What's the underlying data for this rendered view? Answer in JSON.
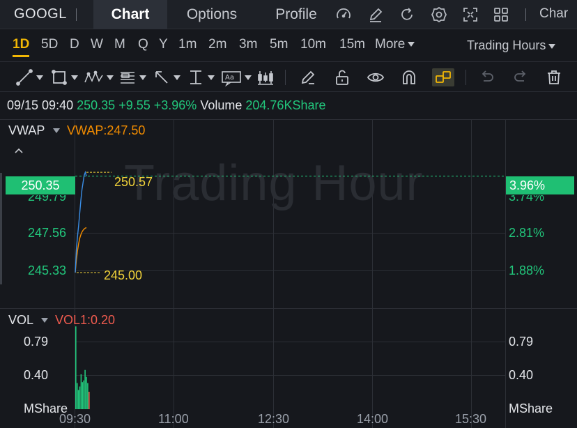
{
  "topbar": {
    "ticker": "GOOGL",
    "tabs": [
      {
        "label": "Chart",
        "active": true
      },
      {
        "label": "Options",
        "active": false
      },
      {
        "label": "Profile",
        "active": false
      }
    ],
    "right_label": "Char",
    "icons": [
      "gauge-icon",
      "edit-icon",
      "refresh-icon",
      "settings-icon",
      "fullscreen-icon",
      "grid-icon"
    ]
  },
  "periods": {
    "items": [
      "1D",
      "5D",
      "D",
      "W",
      "M",
      "Q",
      "Y",
      "1m",
      "2m",
      "3m",
      "5m",
      "10m",
      "15m"
    ],
    "active": "1D",
    "more_label": "More",
    "session_label": "Trading Hours"
  },
  "tools": [
    "trendline-icon",
    "rectangle-icon",
    "pattern-icon",
    "fib-icon",
    "arrow-icon",
    "measure-icon",
    "text-icon",
    "candle-icon",
    "pen-icon",
    "unlock-icon",
    "eye-icon",
    "magnet-icon",
    "link-icon",
    "undo-icon",
    "redo-icon",
    "trash-icon"
  ],
  "quote": {
    "datetime": "09/15 09:40",
    "price": "250.35",
    "change": "+9.55",
    "change_pct": "+3.96%",
    "volume_label": "Volume",
    "volume_value": "204.76KShare"
  },
  "price_panel": {
    "indicator": "VWAP",
    "indicator_value": "VWAP:247.50",
    "watermark": "Trading Hour",
    "last_price_tag": "250.35",
    "last_pct_tag": "3.96%",
    "y_left": [
      "249.79",
      "247.56",
      "245.33"
    ],
    "y_right": [
      "3.74%",
      "2.81%",
      "1.88%"
    ],
    "high_label": "250.57",
    "low_label": "245.00",
    "colors": {
      "price_line": "#3a8ee6",
      "vwap_line": "#f28c00",
      "up": "#22c77c",
      "hilo": "#f2d33a"
    }
  },
  "volume_panel": {
    "indicator": "VOL",
    "indicator_value": "VOL1:0.20",
    "y_left": [
      "0.79",
      "0.40",
      "MShare"
    ],
    "y_right": [
      "0.79",
      "0.40",
      "MShare"
    ]
  },
  "x_axis": [
    "09:30",
    "11:00",
    "12:30",
    "14:00",
    "15:30"
  ],
  "chart_data": {
    "type": "line",
    "x": [
      "09:30",
      "09:31",
      "09:32",
      "09:33",
      "09:34",
      "09:35",
      "09:36",
      "09:37",
      "09:38",
      "09:39",
      "09:40"
    ],
    "series": [
      {
        "name": "VWAP",
        "values": [
          245.0,
          245.7,
          246.2,
          246.6,
          246.9,
          247.1,
          247.25,
          247.35,
          247.42,
          247.47,
          247.5
        ]
      },
      {
        "values": [
          245.0,
          246.3,
          247.0,
          247.6,
          248.3,
          249.0,
          249.6,
          250.0,
          250.4,
          250.57,
          250.35
        ]
      }
    ],
    "volume": [
      0.95,
      0.3,
      0.22,
      0.26,
      0.4,
      0.31,
      0.33,
      0.45,
      0.37,
      0.3,
      0.2
    ],
    "ylim": [
      244.5,
      251.0
    ],
    "volume_ylim": [
      0,
      1.0
    ],
    "ylabel": "",
    "xlabel": ""
  }
}
